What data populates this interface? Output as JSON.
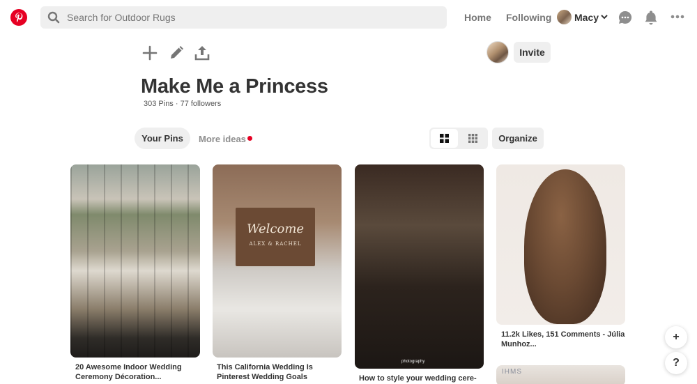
{
  "header": {
    "logo_icon": "pinterest-logo-icon",
    "search_placeholder": "Search for Outdoor Rugs",
    "nav_home": "Home",
    "nav_following": "Following",
    "user_name": "Macy",
    "brand_color": "#e60023"
  },
  "board": {
    "title": "Make Me a Princess",
    "stats": "303 Pins · 77 followers",
    "invite_label": "Invite",
    "tools": [
      "add-icon",
      "pencil-icon",
      "share-icon"
    ]
  },
  "tabs": {
    "your_pins": "Your Pins",
    "more_ideas": "More ideas"
  },
  "toolbar": {
    "organize_label": "Organize"
  },
  "pins": [
    {
      "caption": "20 Awesome Indoor Wedding Ceremony Décoration..."
    },
    {
      "caption": "This California Wedding Is Pinterest Wedding Goals",
      "sign_text": "Welcome",
      "sign_sub": "ALEX & RACHEL"
    },
    {
      "caption": "How to style your wedding cere-",
      "watermark": "photography"
    },
    {
      "caption": "11.2k Likes, 151 Comments - Júlia Munhoz..."
    },
    {
      "watermark": "IHMS"
    }
  ],
  "fabs": {
    "add": "+",
    "help": "?"
  }
}
